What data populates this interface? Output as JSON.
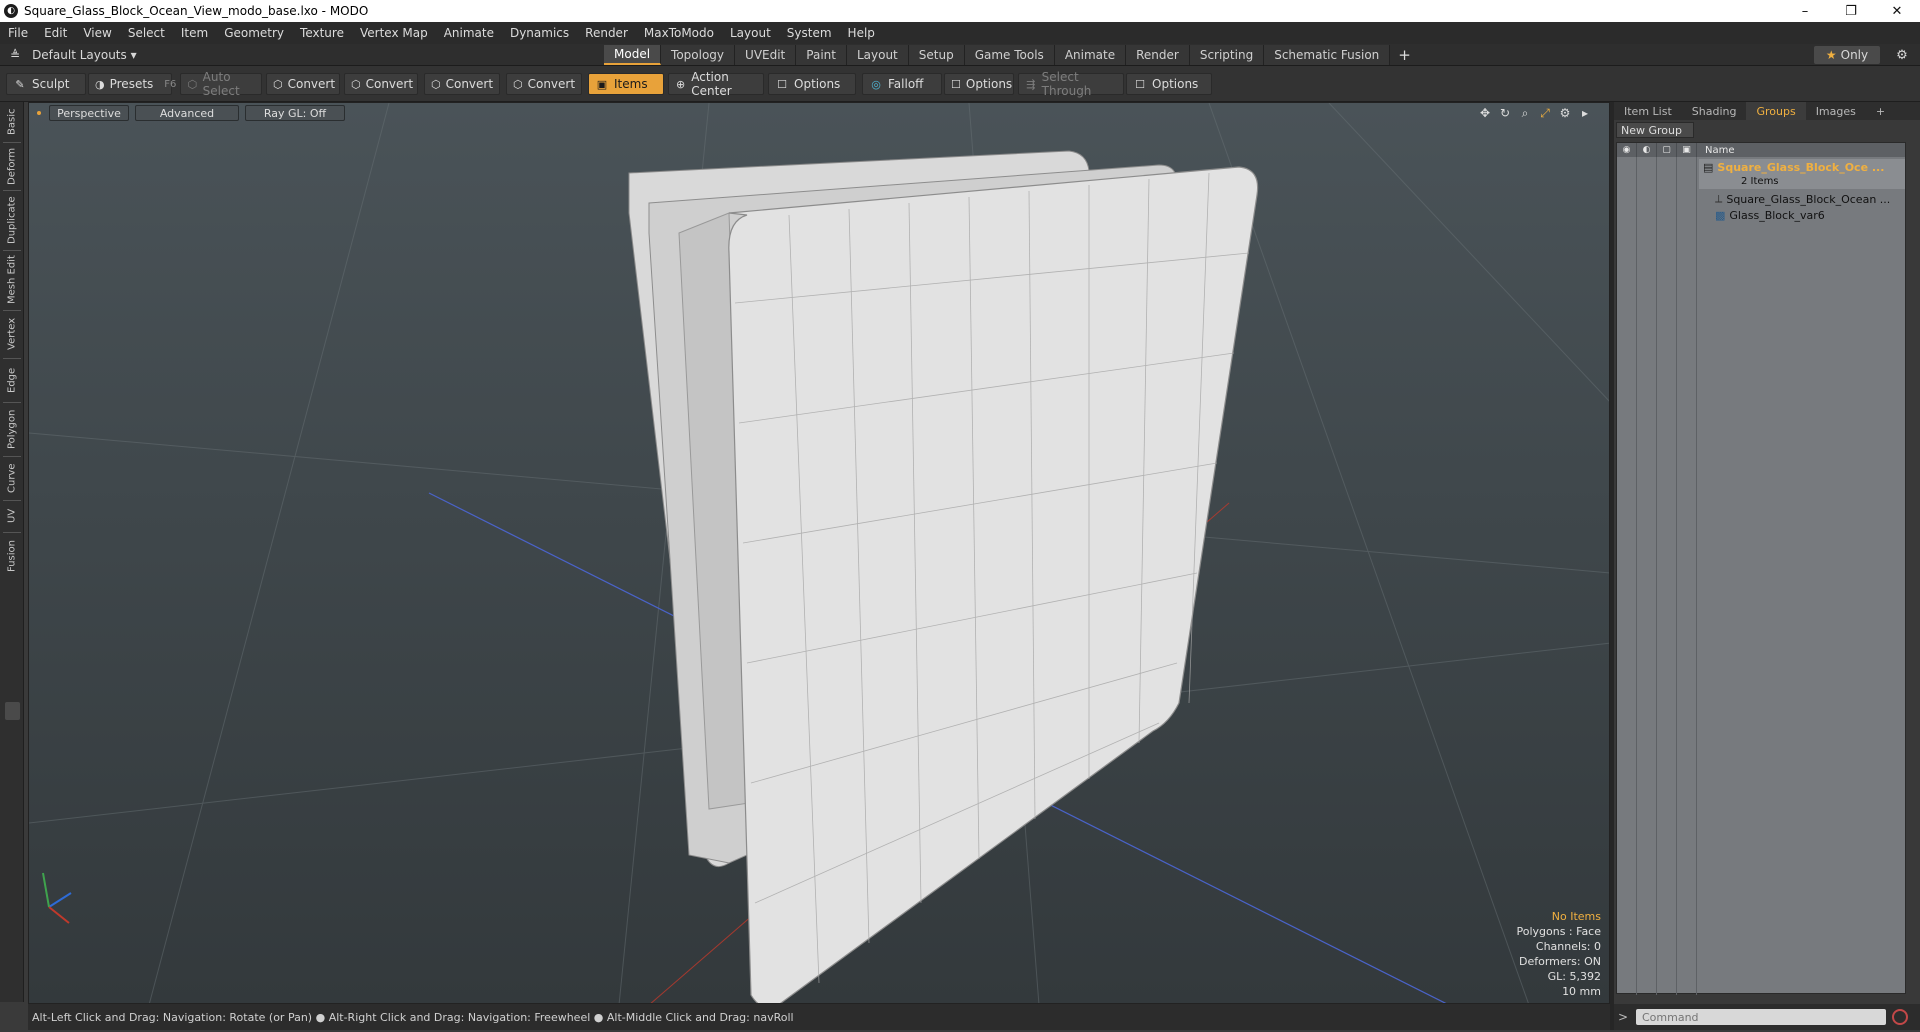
{
  "window": {
    "title": "Square_Glass_Block_Ocean_View_modo_base.lxo - MODO",
    "controls": [
      "–",
      "❐",
      "✕"
    ]
  },
  "menu": [
    "File",
    "Edit",
    "View",
    "Select",
    "Item",
    "Geometry",
    "Texture",
    "Vertex Map",
    "Animate",
    "Dynamics",
    "Render",
    "MaxToModo",
    "Layout",
    "System",
    "Help"
  ],
  "layoutbar": {
    "layouts_label": "Default Layouts ▾",
    "tabs": [
      {
        "label": "Model",
        "active": true
      },
      {
        "label": "Topology"
      },
      {
        "label": "UVEdit"
      },
      {
        "label": "Paint"
      },
      {
        "label": "Layout"
      },
      {
        "label": "Setup"
      },
      {
        "label": "Game Tools"
      },
      {
        "label": "Animate"
      },
      {
        "label": "Render"
      },
      {
        "label": "Scripting"
      },
      {
        "label": "Schematic Fusion"
      }
    ],
    "add_tab": "+",
    "only_label": "Only",
    "only_icon": "★"
  },
  "toolbar": {
    "sculpt": "Sculpt",
    "presets": "Presets",
    "presets_hotkey": "F6",
    "auto_select": "Auto Select",
    "convert1": "Convert",
    "convert2": "Convert",
    "convert3": "Convert",
    "convert4": "Convert",
    "items": "Items",
    "action_center": "Action Center",
    "options1": "Options",
    "falloff": "Falloff",
    "options2": "Options",
    "select_through": "Select Through",
    "options3": "Options"
  },
  "sidetabs": [
    "Basic",
    "Deform",
    "Duplicate",
    "Mesh Edit",
    "Vertex",
    "Edge",
    "Polygon",
    "Curve",
    "UV",
    "Fusion"
  ],
  "viewport": {
    "view_mode": "Perspective",
    "shading": "Advanced",
    "raygl": "Ray GL: Off",
    "stats": {
      "no_items": "No Items",
      "polygons": "Polygons : Face",
      "channels": "Channels: 0",
      "deformers": "Deformers: ON",
      "gl": "GL: 5,392",
      "scale": "10 mm"
    },
    "colors": {
      "accent": "#e8a23a",
      "grid": "#6b7478",
      "axis_x": "#c0392b",
      "axis_z": "#4a63c9"
    }
  },
  "statusbar": {
    "hint": "Alt-Left Click and Drag: Navigation: Rotate (or Pan) ● Alt-Right Click and Drag: Navigation: Freewheel ● Alt-Middle Click and Drag: navRoll"
  },
  "rightpanel": {
    "tabs": [
      {
        "label": "Item List"
      },
      {
        "label": "Shading"
      },
      {
        "label": "Groups",
        "active": true
      },
      {
        "label": "Images"
      },
      {
        "label": "+"
      }
    ],
    "new_group": "New Group",
    "name_header": "Name",
    "group_name": "Square_Glass_Block_Oce ...",
    "group_count": "2 Items",
    "child1": "Square_Glass_Block_Ocean ...",
    "child2": "Glass_Block_var6"
  },
  "command": {
    "prompt": ">",
    "placeholder": "Command"
  }
}
